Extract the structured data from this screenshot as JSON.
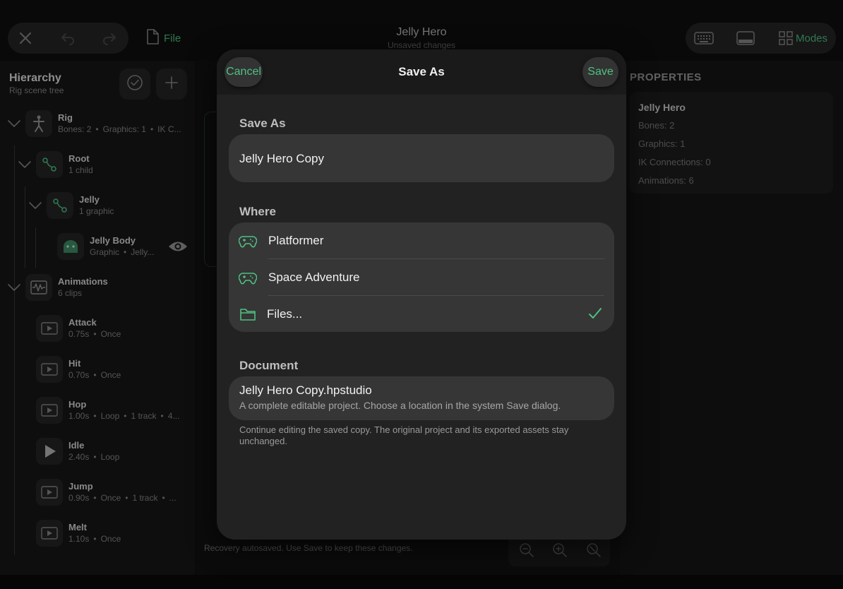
{
  "topbar": {
    "file_label": "File",
    "doc_title": "Jelly Hero",
    "doc_status": "Unsaved changes",
    "modes_label": "Modes"
  },
  "sidebar": {
    "title": "Hierarchy",
    "subtitle": "Rig scene tree",
    "nodes": [
      {
        "name": "Rig",
        "meta": [
          "Bones: 2",
          "Graphics: 1",
          "IK C..."
        ]
      },
      {
        "name": "Root",
        "meta": [
          "1 child"
        ]
      },
      {
        "name": "Jelly",
        "meta": [
          "1 graphic"
        ]
      },
      {
        "name": "Jelly Body",
        "meta": [
          "Graphic",
          "Jelly..."
        ]
      },
      {
        "name": "Animations",
        "meta": [
          "6 clips"
        ]
      },
      {
        "name": "Attack",
        "meta": [
          "0.75s",
          "Once"
        ]
      },
      {
        "name": "Hit",
        "meta": [
          "0.70s",
          "Once"
        ]
      },
      {
        "name": "Hop",
        "meta": [
          "1.00s",
          "Loop",
          "1 track",
          "4..."
        ]
      },
      {
        "name": "Idle",
        "meta": [
          "2.40s",
          "Loop"
        ]
      },
      {
        "name": "Jump",
        "meta": [
          "0.90s",
          "Once",
          "1 track",
          "..."
        ]
      },
      {
        "name": "Melt",
        "meta": [
          "1.10s",
          "Once"
        ]
      }
    ]
  },
  "canvas": {
    "recovery_text": "Recovery autosaved. Use Save to keep these changes."
  },
  "properties": {
    "title": "PROPERTIES",
    "name": "Jelly Hero",
    "lines": [
      "Bones: 2",
      "Graphics: 1",
      "IK Connections: 0",
      "Animations: 6"
    ]
  },
  "modal": {
    "cancel_label": "Cancel",
    "title": "Save As",
    "save_label": "Save",
    "save_as_label": "Save As",
    "filename_value": "Jelly Hero Copy",
    "where_label": "Where",
    "locations": [
      {
        "label": "Platformer",
        "icon": "gamepad-icon",
        "selected": false
      },
      {
        "label": "Space Adventure",
        "icon": "gamepad-icon",
        "selected": false
      },
      {
        "label": "Files...",
        "icon": "folder-icon",
        "selected": true
      }
    ],
    "document_label": "Document",
    "document_name": "Jelly Hero Copy.hpstudio",
    "document_desc": "A complete editable project. Choose a location in the system Save dialog.",
    "note": "Continue editing the saved copy. The original project and its exported assets stay unchanged."
  },
  "colors": {
    "accent": "#4fc082",
    "modal_bg": "#222222",
    "field_bg": "#363636"
  }
}
